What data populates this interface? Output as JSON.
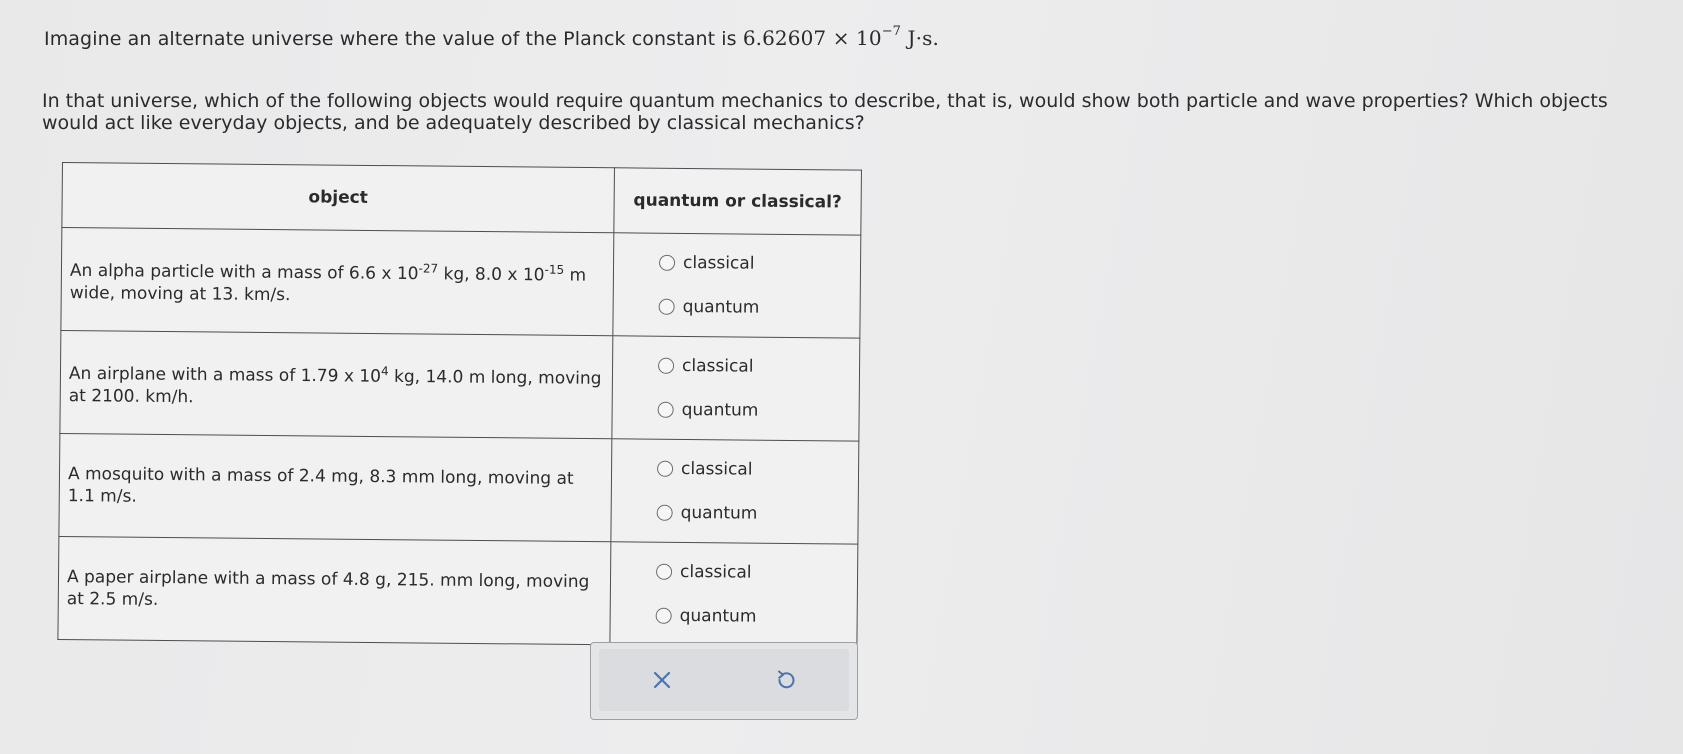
{
  "question": {
    "intro_prefix": "Imagine an alternate universe where the value of the Planck constant is",
    "planck_mantissa": "6.62607",
    "times": "×",
    "planck_base": "10",
    "planck_exponent": "−7",
    "planck_units": "J·s.",
    "body": "In that universe, which of the following objects would require quantum mechanics to describe, that is, would show both particle and wave properties? Which objects would act like everyday objects, and be adequately described by classical mechanics?"
  },
  "table": {
    "headers": [
      "object",
      "quantum or classical?"
    ],
    "rows": [
      {
        "pre": "An alpha particle with a mass of 6.6 x 10",
        "sup1": "-27",
        "mid": " kg, 8.0 x 10",
        "sup2": "-15",
        "post": " m wide, moving at 13. km/s."
      },
      {
        "pre": "An airplane with a mass of 1.79 x 10",
        "sup1": "4",
        "mid": " kg, 14.0 m long, moving at 2100. km/h.",
        "sup2": "",
        "post": ""
      },
      {
        "pre": "A mosquito with a mass of 2.4 mg, 8.3 mm long, moving at 1.1 m/s.",
        "sup1": "",
        "mid": "",
        "sup2": "",
        "post": ""
      },
      {
        "pre": "A paper airplane with a mass of 4.8 g, 215. mm long, moving at 2.5 m/s.",
        "sup1": "",
        "mid": "",
        "sup2": "",
        "post": ""
      }
    ],
    "options": [
      "classical",
      "quantum"
    ]
  },
  "toolbar": {
    "clear_icon": "x-icon",
    "undo_icon": "undo-icon"
  },
  "colors": {
    "text": "#2b2b2e",
    "border": "#4d4d52",
    "toolbar_bg": "#dadcdf"
  }
}
